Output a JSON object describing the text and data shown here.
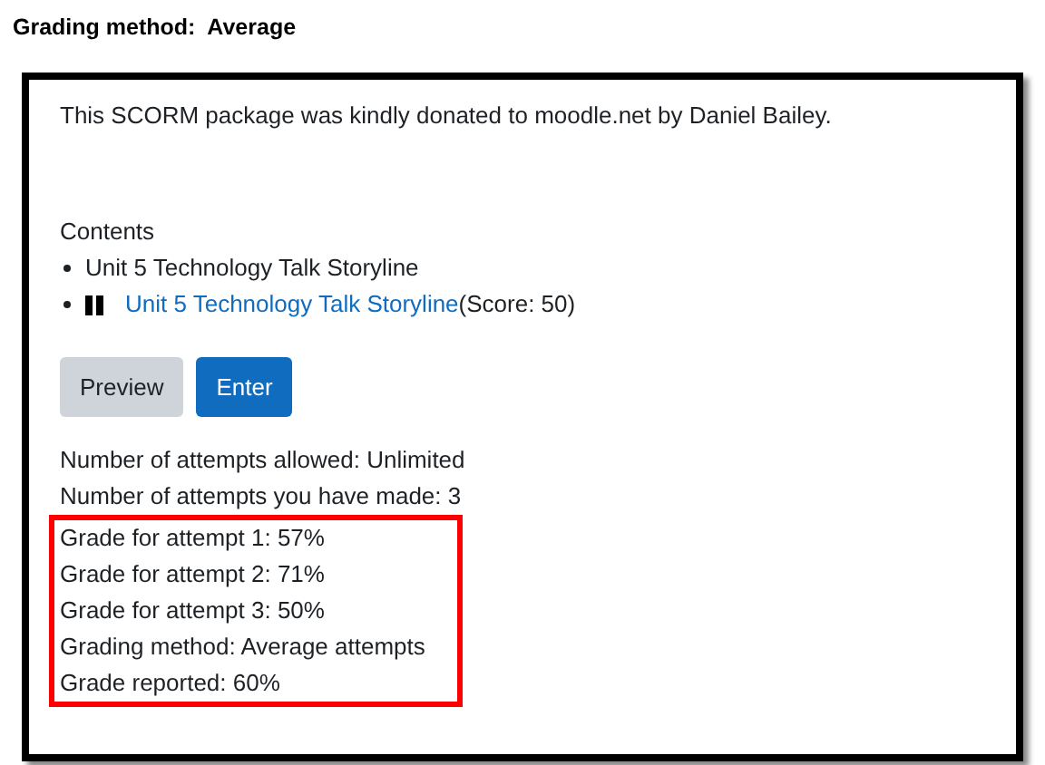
{
  "heading": "Grading method:  Average",
  "description": "This SCORM package was kindly donated to moodle.net by Daniel Bailey.",
  "contents": {
    "label": "Contents",
    "items": [
      {
        "kind": "text",
        "text": "Unit 5 Technology Talk Storyline"
      },
      {
        "kind": "link",
        "text": "Unit 5 Technology Talk Storyline",
        "suffix": "(Score: 50)"
      }
    ]
  },
  "buttons": [
    {
      "label": "Preview",
      "kind": "secondary"
    },
    {
      "label": "Enter",
      "kind": "primary"
    }
  ],
  "attempt_info": [
    "Number of attempts allowed: Unlimited",
    "Number of attempts you have made: 3"
  ],
  "highlighted_info": [
    "Grade for attempt 1: 57%",
    "Grade for attempt 2: 71%",
    "Grade for attempt 3: 50%",
    "Grading method: Average attempts",
    "Grade reported: 60%"
  ]
}
